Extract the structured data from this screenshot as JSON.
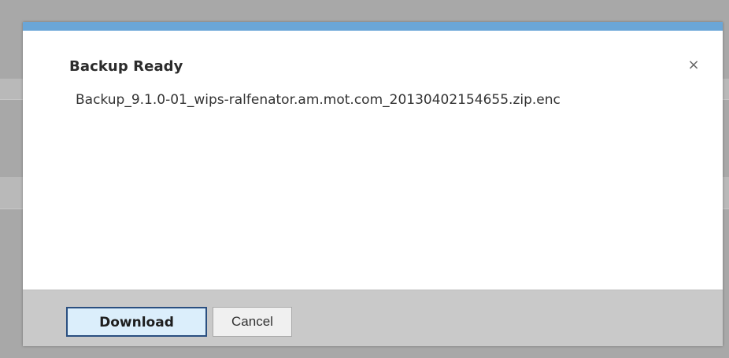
{
  "dialog": {
    "title": "Backup Ready",
    "close_symbol": "×",
    "filename": "Backup_9.1.0-01_wips-ralfenator.am.mot.com_20130402154655.zip.enc",
    "accent_color": "#6aa6d8"
  },
  "footer": {
    "download_label": "Download",
    "cancel_label": "Cancel"
  }
}
